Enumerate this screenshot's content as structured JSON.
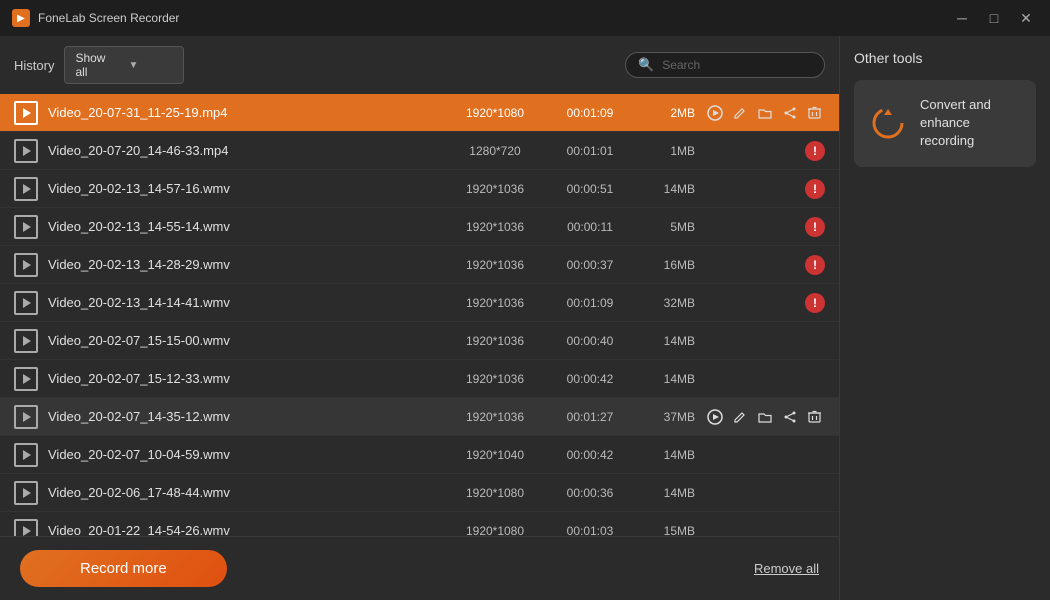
{
  "titleBar": {
    "appName": "FoneLab Screen Recorder",
    "controls": {
      "minimize": "─",
      "maximize": "□",
      "close": "✕"
    }
  },
  "historyBar": {
    "label": "History",
    "filterLabel": "Show all",
    "searchPlaceholder": "Search"
  },
  "fileList": [
    {
      "id": 1,
      "name": "Video_20-07-31_11-25-19.mp4",
      "res": "1920*1080",
      "dur": "00:01:09",
      "size": "2MB",
      "selected": true,
      "error": false,
      "showActions": true
    },
    {
      "id": 2,
      "name": "Video_20-07-20_14-46-33.mp4",
      "res": "1280*720",
      "dur": "00:01:01",
      "size": "1MB",
      "selected": false,
      "error": true,
      "showActions": false
    },
    {
      "id": 3,
      "name": "Video_20-02-13_14-57-16.wmv",
      "res": "1920*1036",
      "dur": "00:00:51",
      "size": "14MB",
      "selected": false,
      "error": true,
      "showActions": false
    },
    {
      "id": 4,
      "name": "Video_20-02-13_14-55-14.wmv",
      "res": "1920*1036",
      "dur": "00:00:11",
      "size": "5MB",
      "selected": false,
      "error": true,
      "showActions": false
    },
    {
      "id": 5,
      "name": "Video_20-02-13_14-28-29.wmv",
      "res": "1920*1036",
      "dur": "00:00:37",
      "size": "16MB",
      "selected": false,
      "error": true,
      "showActions": false
    },
    {
      "id": 6,
      "name": "Video_20-02-13_14-14-41.wmv",
      "res": "1920*1036",
      "dur": "00:01:09",
      "size": "32MB",
      "selected": false,
      "error": true,
      "showActions": false
    },
    {
      "id": 7,
      "name": "Video_20-02-07_15-15-00.wmv",
      "res": "1920*1036",
      "dur": "00:00:40",
      "size": "14MB",
      "selected": false,
      "error": false,
      "showActions": false
    },
    {
      "id": 8,
      "name": "Video_20-02-07_15-12-33.wmv",
      "res": "1920*1036",
      "dur": "00:00:42",
      "size": "14MB",
      "selected": false,
      "error": false,
      "showActions": false
    },
    {
      "id": 9,
      "name": "Video_20-02-07_14-35-12.wmv",
      "res": "1920*1036",
      "dur": "00:01:27",
      "size": "37MB",
      "selected": false,
      "error": false,
      "showActions": true,
      "hovered": true
    },
    {
      "id": 10,
      "name": "Video_20-02-07_10-04-59.wmv",
      "res": "1920*1040",
      "dur": "00:00:42",
      "size": "14MB",
      "selected": false,
      "error": false,
      "showActions": false
    },
    {
      "id": 11,
      "name": "Video_20-02-06_17-48-44.wmv",
      "res": "1920*1080",
      "dur": "00:00:36",
      "size": "14MB",
      "selected": false,
      "error": false,
      "showActions": false
    },
    {
      "id": 12,
      "name": "Video_20-01-22_14-54-26.wmv",
      "res": "1920*1080",
      "dur": "00:01:03",
      "size": "15MB",
      "selected": false,
      "error": false,
      "showActions": false
    }
  ],
  "bottomBar": {
    "recordMore": "Record more",
    "removeAll": "Remove all"
  },
  "rightPanel": {
    "title": "Other tools",
    "tools": [
      {
        "label": "Convert and enhance recording"
      }
    ]
  }
}
